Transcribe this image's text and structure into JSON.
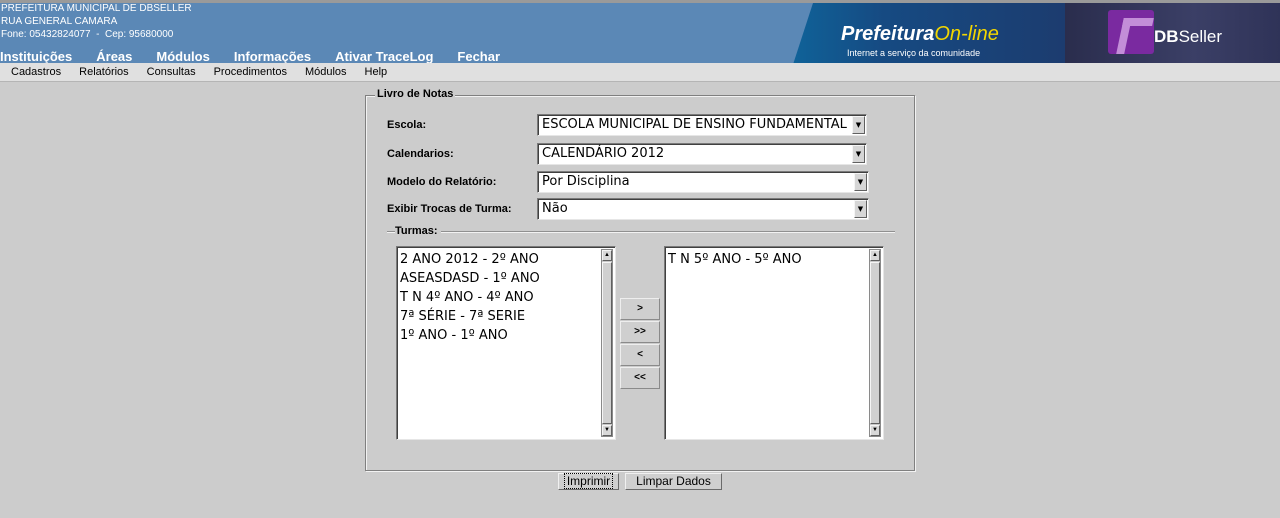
{
  "header": {
    "lines": [
      "PREFEITURA MUNICIPAL DE DBSELLER",
      "RUA GENERAL CAMARA",
      "Fone: 05432824077  -  Cep: 95680000"
    ],
    "nav": [
      "Instituições",
      "Áreas",
      "Módulos",
      "Informações",
      "Ativar TraceLog",
      "Fechar"
    ],
    "brand": {
      "bold": "Prefeitura",
      "online": "On-line",
      "tagline": "Internet a serviço da comunidade"
    },
    "dbseller": {
      "bold": "DB",
      "rest": "Seller"
    }
  },
  "menubar": [
    "Cadastros",
    "Relatórios",
    "Consultas",
    "Procedimentos",
    "Módulos",
    "Help"
  ],
  "form": {
    "legend": "Livro de Notas",
    "escola": {
      "label": "Escola:",
      "value": "ESCOLA MUNICIPAL DE ENSINO FUNDAMENTAL"
    },
    "calendarios": {
      "label": "Calendarios:",
      "value": "CALENDÁRIO 2012"
    },
    "modelo": {
      "label": "Modelo do Relatório:",
      "value": "Por Disciplina"
    },
    "exibir": {
      "label": "Exibir Trocas de Turma:",
      "value": "Não"
    },
    "turmas": {
      "label": "Turmas:",
      "available": [
        "2 ANO 2012 - 2º ANO",
        "ASEASDASD - 1º ANO",
        "T N 4º ANO - 4º ANO",
        "7ª SÉRIE - 7ª SERIE",
        "1º ANO - 1º ANO"
      ],
      "selected": [
        "T N 5º ANO - 5º ANO"
      ],
      "move_buttons": [
        ">",
        ">>",
        "<",
        "<<"
      ]
    },
    "buttons": {
      "print": "Imprimir",
      "clear": "Limpar Dados"
    }
  },
  "icons": {
    "dropdown": "chevron-down-icon",
    "scroll_up": "arrow-up-icon",
    "scroll_down": "arrow-down-icon"
  }
}
